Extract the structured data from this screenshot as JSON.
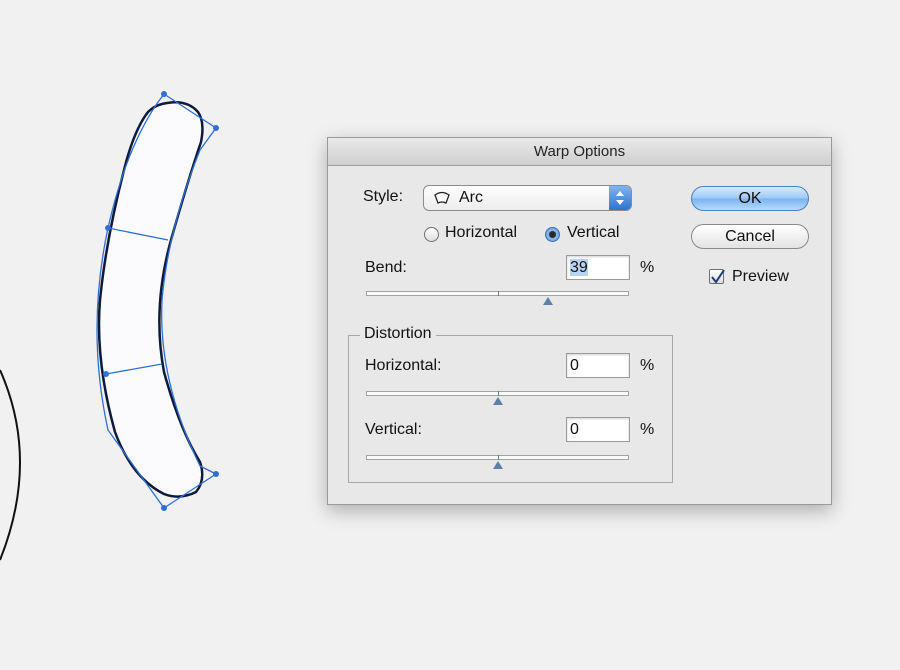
{
  "dialog": {
    "title": "Warp Options",
    "style_label": "Style:",
    "style_value": "Arc",
    "orientation": {
      "horizontal_label": "Horizontal",
      "vertical_label": "Vertical",
      "selected": "Vertical"
    },
    "bend": {
      "label": "Bend:",
      "value": "39",
      "unit": "%"
    },
    "distortion": {
      "title": "Distortion",
      "horizontal": {
        "label": "Horizontal:",
        "value": "0",
        "unit": "%"
      },
      "vertical": {
        "label": "Vertical:",
        "value": "0",
        "unit": "%"
      }
    },
    "ok_label": "OK",
    "cancel_label": "Cancel",
    "preview_label": "Preview",
    "preview_checked": true
  },
  "colors": {
    "accent": "#2e73cf",
    "path_blue": "#2f6fd6",
    "outline": "#1a1a1a"
  }
}
